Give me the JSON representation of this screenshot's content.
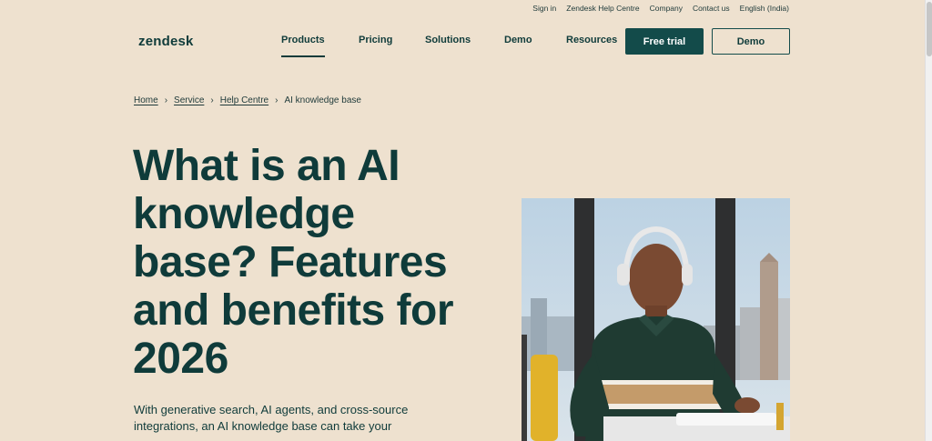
{
  "utility_nav": [
    "Sign in",
    "Zendesk Help Centre",
    "Company",
    "Contact us",
    "English (India)"
  ],
  "logo": "zendesk",
  "main_nav": [
    {
      "label": "Products",
      "active": true
    },
    {
      "label": "Pricing"
    },
    {
      "label": "Solutions"
    },
    {
      "label": "Demo"
    },
    {
      "label": "Resources"
    }
  ],
  "cta": {
    "free_trial": "Free trial",
    "demo": "Demo"
  },
  "breadcrumb": [
    "Home",
    "Service",
    "Help Centre",
    "AI knowledge base"
  ],
  "hero": {
    "title": "What is an AI knowledge base? Features and benefits for 2026",
    "subtitle": "With generative search, AI agents, and cross-source integrations, an AI knowledge base can take your"
  },
  "colors": {
    "background": "#eee1cf",
    "brand": "#134b4a",
    "text": "#0f3b3a"
  }
}
